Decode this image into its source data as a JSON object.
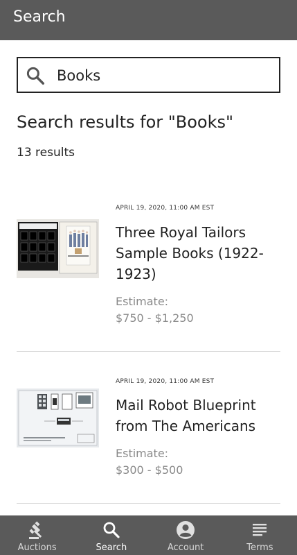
{
  "header": {
    "title": "Search"
  },
  "search": {
    "value": "Books",
    "placeholder": ""
  },
  "results_heading": "Search results for \"Books\"",
  "results_count": "13 results",
  "results": [
    {
      "date": "APRIL 19, 2020, 11:00 AM EST",
      "title": "Three Royal Tailors Sample Books (1922-1923)",
      "estimate_label": "Estimate:",
      "estimate_range": "$750 - $1,250"
    },
    {
      "date": "APRIL 19, 2020, 11:00 AM EST",
      "title": "Mail Robot Blueprint from The Americans",
      "estimate_label": "Estimate:",
      "estimate_range": "$300 - $500"
    }
  ],
  "nav": [
    {
      "label": "Auctions",
      "icon": "gavel-icon",
      "active": false
    },
    {
      "label": "Search",
      "icon": "search-icon",
      "active": true
    },
    {
      "label": "Account",
      "icon": "account-icon",
      "active": false
    },
    {
      "label": "Terms",
      "icon": "terms-icon",
      "active": false
    }
  ],
  "colors": {
    "appbar": "#5a5a5a",
    "text": "#222222",
    "muted": "#8a8a8a",
    "divider": "#d6d6d6"
  }
}
